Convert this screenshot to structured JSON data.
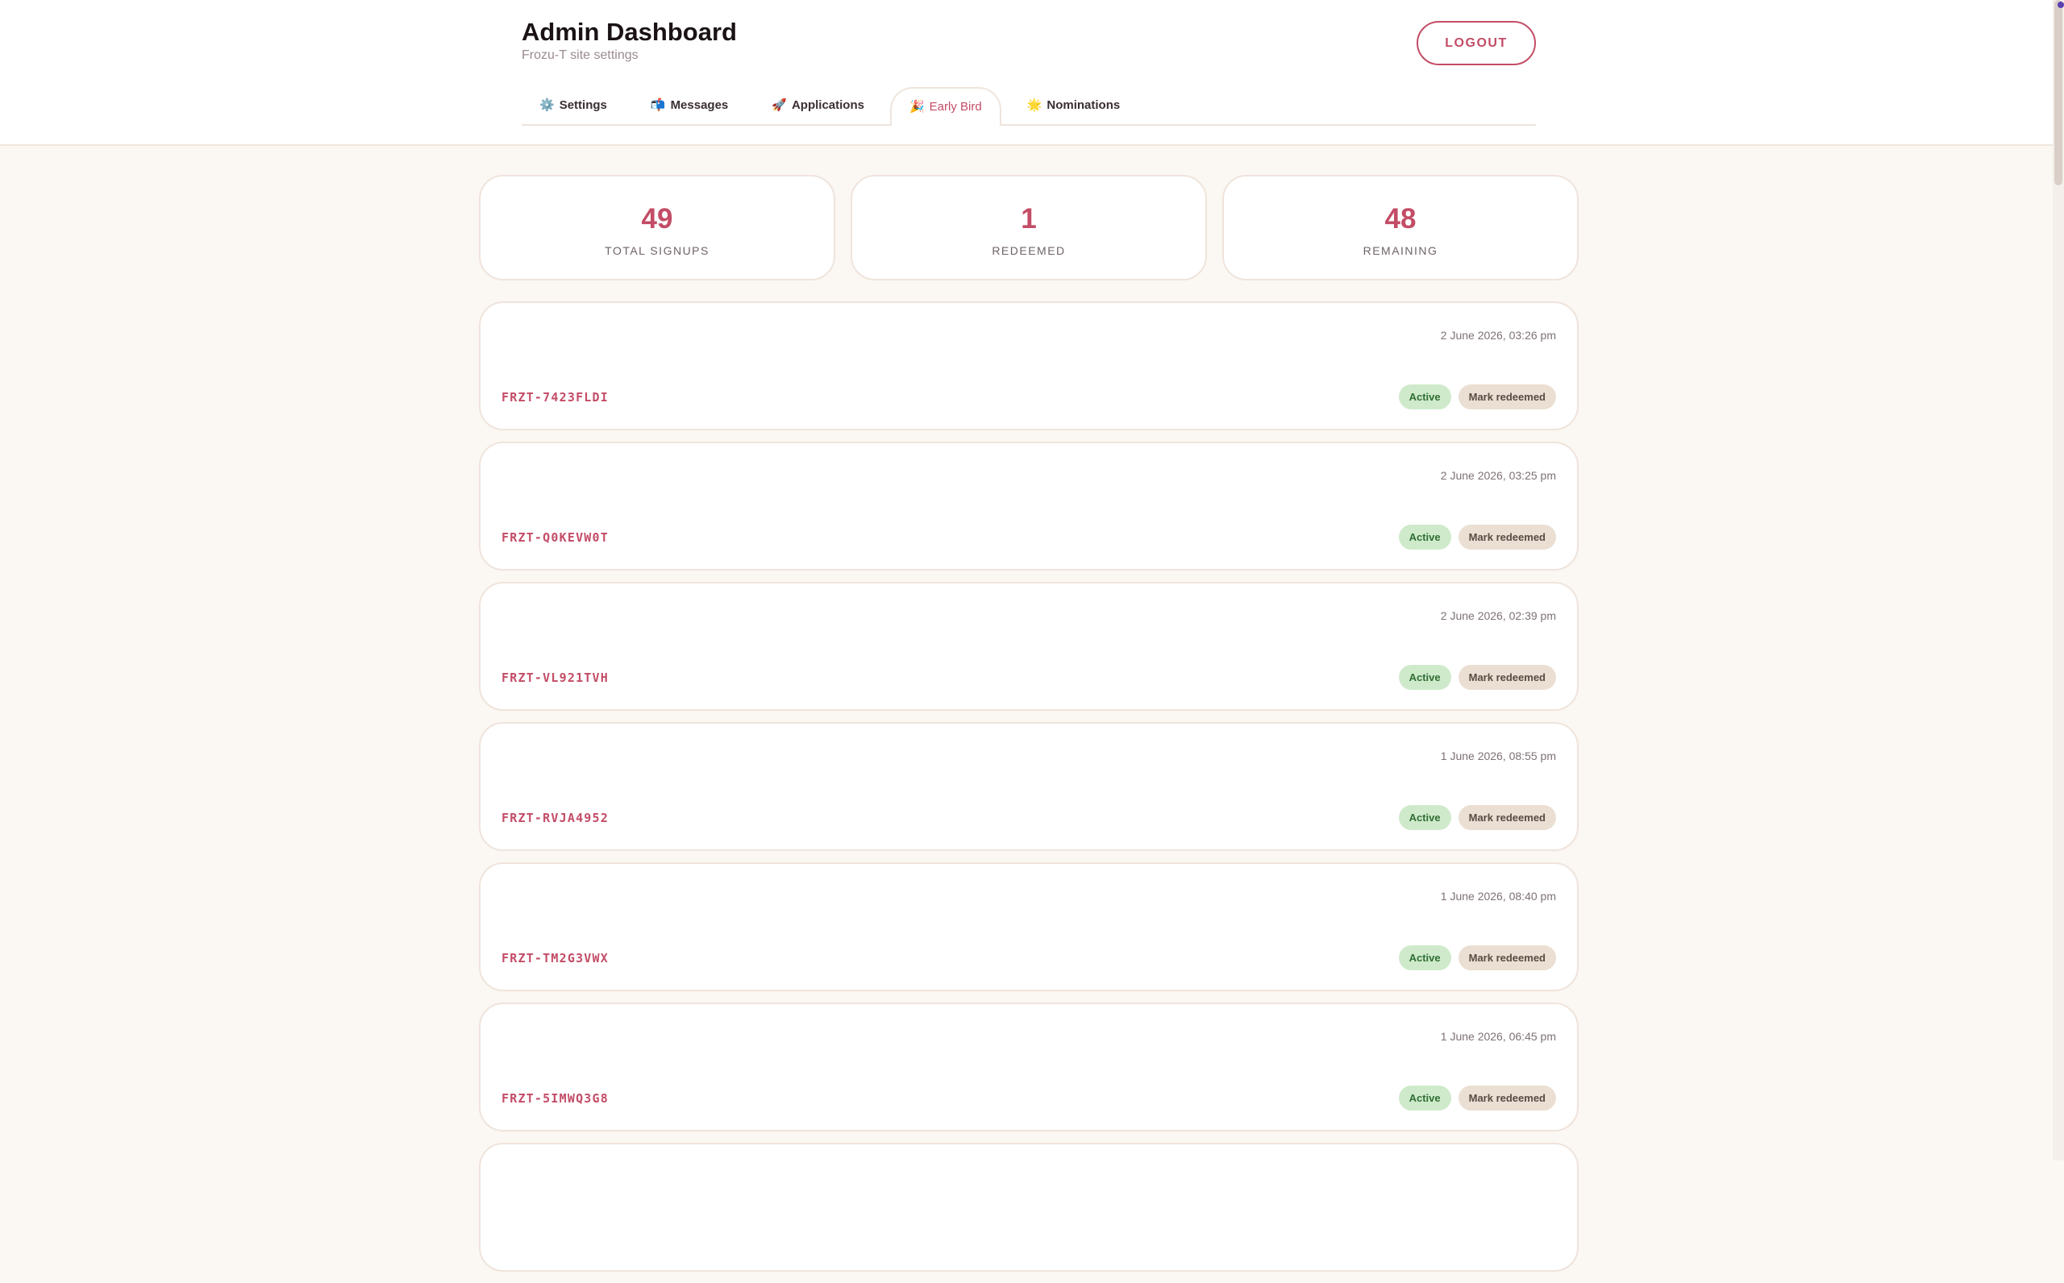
{
  "header": {
    "title": "Admin Dashboard",
    "subtitle": "Frozu-T site settings",
    "logout_label": "LOGOUT"
  },
  "tabs": [
    {
      "icon": "⚙️",
      "icon_name": "gear-icon",
      "label": "Settings",
      "active": false
    },
    {
      "icon": "📬",
      "icon_name": "mailbox-icon",
      "label": "Messages",
      "active": false
    },
    {
      "icon": "🚀",
      "icon_name": "rocket-icon",
      "label": "Applications",
      "active": false
    },
    {
      "icon": "🎉",
      "icon_name": "party-popper-icon",
      "label": "Early Bird",
      "active": true
    },
    {
      "icon": "🌟",
      "icon_name": "star-icon",
      "label": "Nominations",
      "active": false
    }
  ],
  "stats": [
    {
      "value": "49",
      "label": "TOTAL SIGNUPS"
    },
    {
      "value": "1",
      "label": "REDEEMED"
    },
    {
      "value": "48",
      "label": "REMAINING"
    }
  ],
  "entries": [
    {
      "date": "2 June 2026, 03:26 pm",
      "code": "FRZT-7423FLDI",
      "status": "Active",
      "action": "Mark redeemed"
    },
    {
      "date": "2 June 2026, 03:25 pm",
      "code": "FRZT-Q0KEVW0T",
      "status": "Active",
      "action": "Mark redeemed"
    },
    {
      "date": "2 June 2026, 02:39 pm",
      "code": "FRZT-VL921TVH",
      "status": "Active",
      "action": "Mark redeemed"
    },
    {
      "date": "1 June 2026, 08:55 pm",
      "code": "FRZT-RVJA4952",
      "status": "Active",
      "action": "Mark redeemed"
    },
    {
      "date": "1 June 2026, 08:40 pm",
      "code": "FRZT-TM2G3VWX",
      "status": "Active",
      "action": "Mark redeemed"
    },
    {
      "date": "1 June 2026, 06:45 pm",
      "code": "FRZT-5IMWQ3G8",
      "status": "Active",
      "action": "Mark redeemed"
    }
  ],
  "colors": {
    "accent": "#c34c66",
    "background": "#fbf7f2",
    "active_badge": "#cfeacb",
    "redeem_button": "#eadfd2"
  }
}
